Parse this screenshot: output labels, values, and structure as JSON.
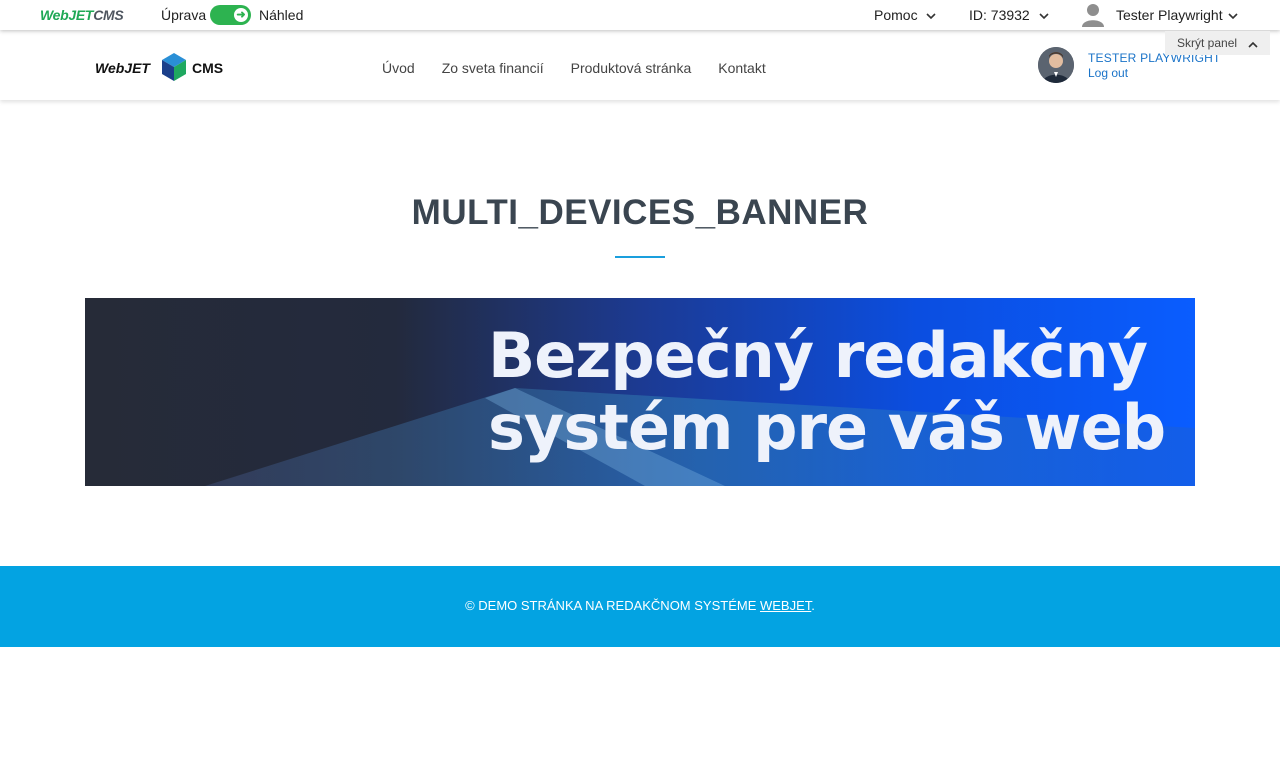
{
  "admin_bar": {
    "logo_web": "WebJET",
    "logo_cms": "CMS",
    "edit_label": "Úprava",
    "preview_label": "Náhled",
    "help_label": "Pomoc",
    "id_label": "ID: 73932",
    "user_label": "Tester Playwright",
    "hide_panel_label": "Skrýt panel"
  },
  "site_header": {
    "logo_left": "WebJET",
    "logo_right": "CMS",
    "nav": [
      "Úvod",
      "Zo sveta financií",
      "Produktová stránka",
      "Kontakt"
    ],
    "profile_name": "TESTER PLAYWRIGHT",
    "logout_label": "Log out"
  },
  "main": {
    "title": "MULTI_DEVICES_BANNER",
    "banner_line1": "Bezpečný redakčný",
    "banner_line2": "systém pre váš web"
  },
  "footer": {
    "text": "© DEMO STRÁNKA NA REDAKČNOM SYSTÉME ",
    "link": "WEBJET",
    "suffix": "."
  },
  "colors": {
    "toggle": "#2db350",
    "footer": "#03a3e2",
    "accent": "#1a9fdd",
    "link": "#1a73c8"
  },
  "icons": [
    "chevron-down-icon",
    "user-icon",
    "chevron-up-icon",
    "arrow-right-icon"
  ]
}
